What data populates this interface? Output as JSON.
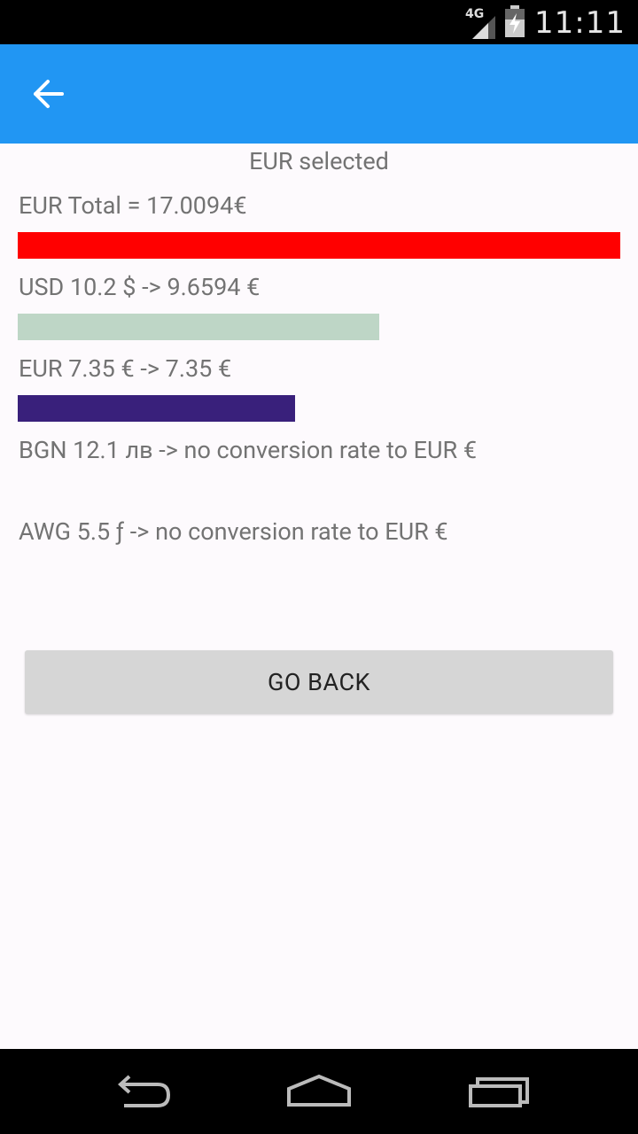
{
  "status_bar": {
    "network_label": "4G",
    "time": "11:11"
  },
  "header": {
    "background_color": "#2196f3",
    "back_icon": "arrow-back-icon"
  },
  "content": {
    "title": "EUR selected",
    "total_label": "EUR Total = 17.0094€",
    "total_bar": {
      "color": "#ff0000",
      "fraction": 1.0
    },
    "conversions": [
      {
        "text": "USD 10.2 $ -> 9.6594 €",
        "bar_color": "#bed6c6",
        "bar_fraction": 0.6
      },
      {
        "text": "EUR 7.35 € -> 7.35 €",
        "bar_color": "#39207b",
        "bar_fraction": 0.46
      },
      {
        "text": "BGN 12.1 лв -> no conversion rate to EUR €"
      },
      {
        "text": "AWG 5.5 ƒ -> no conversion rate to EUR €"
      }
    ],
    "go_back_label": "GO BACK"
  },
  "nav_bar": {
    "buttons": [
      "back-icon",
      "home-icon",
      "recents-icon"
    ]
  }
}
